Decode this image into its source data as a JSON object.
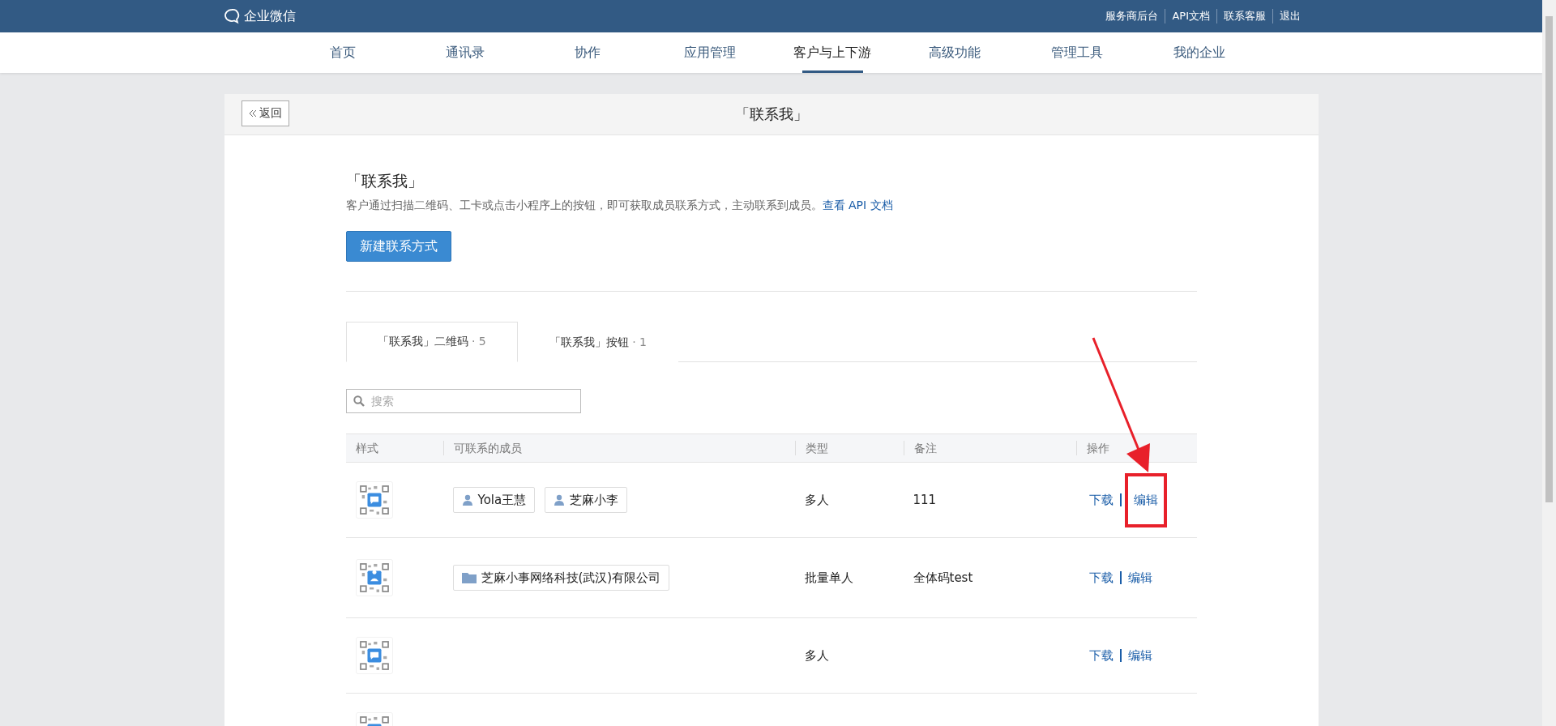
{
  "topbar": {
    "logo": "企业微信",
    "links": [
      "服务商后台",
      "API文档",
      "联系客服",
      "退出"
    ]
  },
  "nav": [
    {
      "label": "首页",
      "selected": false
    },
    {
      "label": "通讯录",
      "selected": false
    },
    {
      "label": "协作",
      "selected": false
    },
    {
      "label": "应用管理",
      "selected": false
    },
    {
      "label": "客户与上下游",
      "selected": true
    },
    {
      "label": "高级功能",
      "selected": false
    },
    {
      "label": "管理工具",
      "selected": false
    },
    {
      "label": "我的企业",
      "selected": false
    }
  ],
  "card": {
    "back": "返回",
    "title": "「联系我」"
  },
  "intro": {
    "title": "「联系我」",
    "description": "客户通过扫描二维码、工卡或点击小程序上的按钮，即可获取成员联系方式，主动联系到成员。",
    "link": "查看 API 文档",
    "button": "新建联系方式"
  },
  "tabs": [
    {
      "label": "「联系我」二维码",
      "count": "· 5",
      "selected": true
    },
    {
      "label": "「联系我」按钮",
      "count": "· 1",
      "selected": false
    }
  ],
  "search": {
    "placeholder": "搜索"
  },
  "table": {
    "columns": [
      "样式",
      "可联系的成员",
      "类型",
      "备注",
      "操作"
    ],
    "rows": [
      {
        "kind": "message",
        "members": [
          {
            "kind": "person",
            "name": "Yola王慧"
          },
          {
            "kind": "person",
            "name": "芝麻小李"
          }
        ],
        "type": "多人",
        "note": "111",
        "actions": [
          "下载",
          "编辑"
        ],
        "highlighted": true
      },
      {
        "kind": "person",
        "members": [
          {
            "kind": "department",
            "name": "芝麻小事网络科技(武汉)有限公司"
          }
        ],
        "type": "批量单人",
        "note": "全体码test",
        "actions": [
          "下载",
          "编辑"
        ]
      },
      {
        "kind": "message",
        "members": [],
        "type": "多人",
        "actions": [
          "下载",
          "编辑"
        ]
      },
      {
        "kind": "message",
        "members": []
      }
    ]
  }
}
